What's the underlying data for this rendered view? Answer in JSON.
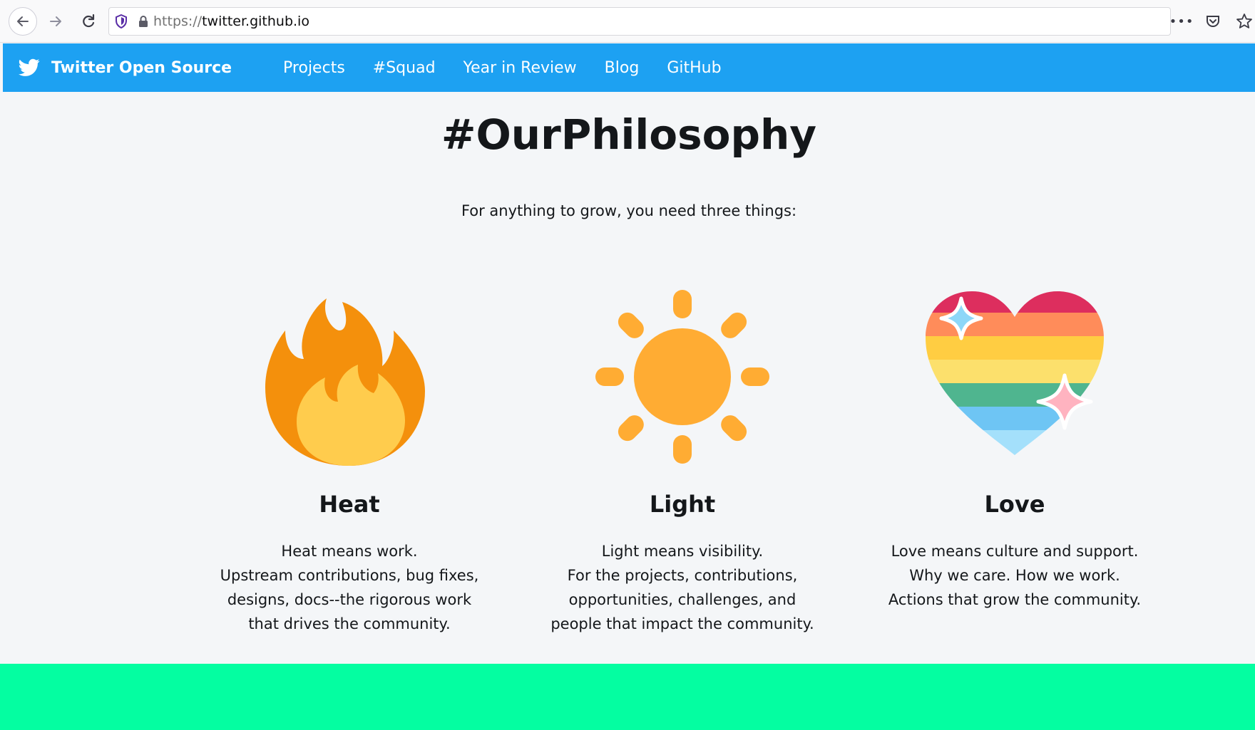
{
  "browser": {
    "url_protocol": "https://",
    "url_host": "twitter.github.io",
    "more_label": "•••"
  },
  "header": {
    "brand": "Twitter Open Source",
    "nav": [
      "Projects",
      "#Squad",
      "Year in Review",
      "Blog",
      "GitHub"
    ]
  },
  "main": {
    "title": "#OurPhilosophy",
    "subtitle": "For anything to grow, you need three things:",
    "columns": [
      {
        "icon": "fire-icon",
        "title": "Heat",
        "lines": [
          "Heat means work.",
          "Upstream contributions, bug fixes,",
          "designs, docs--the rigorous work",
          "that drives the community."
        ]
      },
      {
        "icon": "sun-icon",
        "title": "Light",
        "lines": [
          "Light means visibility.",
          "For the projects, contributions,",
          "opportunities, challenges, and",
          "people that impact the community."
        ]
      },
      {
        "icon": "rainbow-heart-icon",
        "title": "Love",
        "lines": [
          "Love means culture and support.",
          "Why we care. How we work.",
          "Actions that grow the community."
        ]
      }
    ]
  },
  "colors": {
    "header_bg": "#1da1f2",
    "page_bg": "#f4f6f8",
    "band_bg": "#04fea1",
    "fire_outer": "#f4900c",
    "fire_inner": "#ffcc4d",
    "sun": "#ffac33"
  }
}
